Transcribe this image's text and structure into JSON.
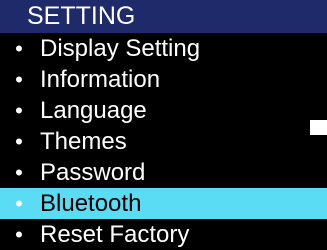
{
  "header": {
    "title": "SETTING"
  },
  "menu": {
    "bullet": "•",
    "selected_index": 5,
    "items": [
      {
        "label": "Display Setting"
      },
      {
        "label": "Information"
      },
      {
        "label": "Language"
      },
      {
        "label": "Themes"
      },
      {
        "label": "Password"
      },
      {
        "label": "Bluetooth"
      },
      {
        "label": "Reset Factory"
      }
    ]
  },
  "colors": {
    "background": "#000000",
    "header_background": "#1f2a6b",
    "text": "#ffffff",
    "selection_highlight": "#5bdcf5",
    "selected_text": "#000000"
  }
}
